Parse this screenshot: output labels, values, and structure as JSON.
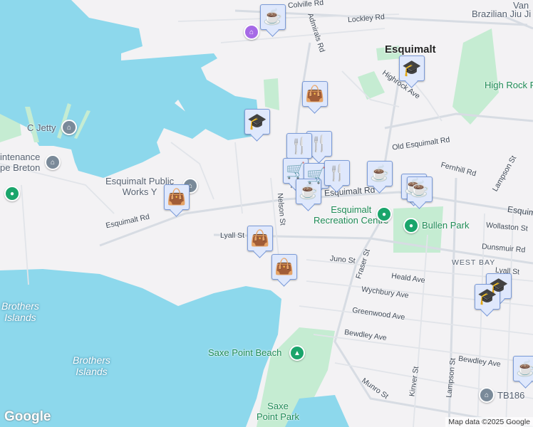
{
  "colors": {
    "water": "#8dd8ec",
    "land": "#f3f2f4",
    "park": "#c5ecd2",
    "marker_bg": "#dfe8fc",
    "marker_icon": "#0c466b"
  },
  "labels": {
    "colville": "Colville Rd",
    "lockley": "Lockley Rd",
    "admirals": "Admirals Rd",
    "van": "Van",
    "bjj": "Brazilian Jiu Ji",
    "esquimalt": "Esquimalt",
    "highrock": "Highrock Ave",
    "highrock_park": "High Rock Park",
    "c_jetty": "C Jetty",
    "maintenance": "intenance",
    "cape_breton": "pe Breton",
    "public_works_1": "Esquimalt Public",
    "public_works_2": "Works Y",
    "old_esq": "Old Esquimalt Rd",
    "fernhill": "Fernhill Rd",
    "lampson_n": "Lampson St",
    "esq_rd_w": "Esquimalt Rd",
    "esq_rd_c": "Esquimalt Rd",
    "esq_rd_e": "Esquima",
    "rec_1": "Esquimalt",
    "rec_2": "Recreation Centre",
    "bullen": "Bullen Park",
    "wollaston": "Wollaston St",
    "dunsmuir": "Dunsmuir Rd",
    "west_bay": "WEST BAY",
    "lyall_w": "Lyall St",
    "lyall_e": "Lyall St",
    "nelson": "Nelson St",
    "juno": "Juno St",
    "fraser": "Fraser St",
    "heald": "Heald Ave",
    "wychbury": "Wychbury Ave",
    "greenwood": "Greenwood Ave",
    "bewdley_w": "Bewdley Ave",
    "bewdley_e": "Bewdley Ave",
    "brothers_1a": "Brothers",
    "brothers_1b": "Islands",
    "brothers_2a": "Brothers",
    "brothers_2b": "Islands",
    "saxe_beach": "Saxe Point Beach",
    "saxe_park_1": "Saxe",
    "saxe_park_2": "Point Park",
    "munro": "Munro St",
    "kinver": "Kinver St",
    "lampson_s": "Lampson St",
    "tb186": "TB186",
    "ave": "Ave"
  },
  "markers": [
    {
      "type": "cafe",
      "icon": "☕"
    },
    {
      "type": "shopping",
      "icon": "👜"
    },
    {
      "type": "school",
      "icon": "🎓"
    },
    {
      "type": "school",
      "icon": "🎓"
    },
    {
      "type": "shopping",
      "icon": "👜"
    },
    {
      "type": "restaurant",
      "icon": "🍴"
    },
    {
      "type": "restaurant",
      "icon": "🍴"
    },
    {
      "type": "grocery",
      "icon": "🛒"
    },
    {
      "type": "grocery",
      "icon": "🛒"
    },
    {
      "type": "restaurant",
      "icon": "🍴"
    },
    {
      "type": "cafe",
      "icon": "☕"
    },
    {
      "type": "cafe",
      "icon": "☕"
    },
    {
      "type": "cafe",
      "icon": "☕"
    },
    {
      "type": "cafe",
      "icon": "☕"
    },
    {
      "type": "shopping",
      "icon": "👜"
    },
    {
      "type": "shopping",
      "icon": "👜"
    },
    {
      "type": "school",
      "icon": "🎓"
    },
    {
      "type": "school",
      "icon": "🎓"
    },
    {
      "type": "cafe",
      "icon": "☕"
    }
  ],
  "footer": {
    "logo": "Google",
    "attribution": "Map data ©2025 Google"
  }
}
